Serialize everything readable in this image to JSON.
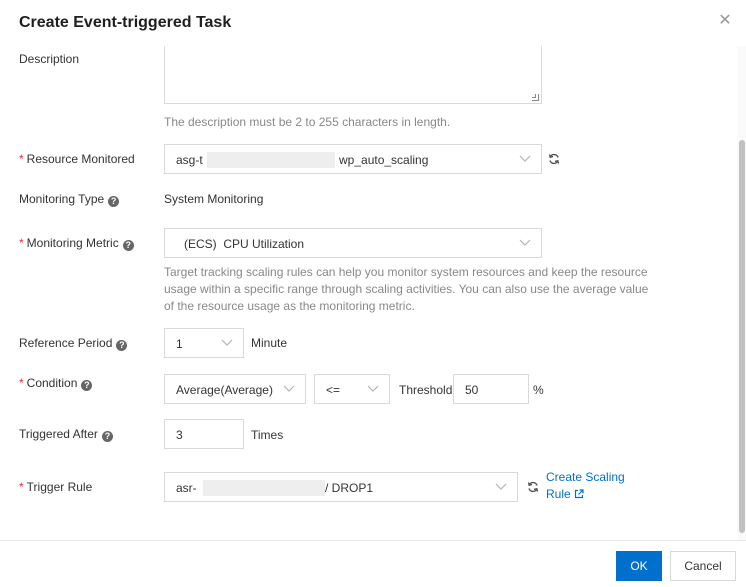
{
  "dialog": {
    "title": "Create Event-triggered Task"
  },
  "form": {
    "description": {
      "label": "Description",
      "value": "",
      "hint": "The description must be 2 to 255 characters in length."
    },
    "resource_monitored": {
      "label": "Resource Monitored",
      "value_prefix": "asg-t",
      "value_suffix": "wp_auto_scaling"
    },
    "monitoring_type": {
      "label": "Monitoring Type",
      "value": "System Monitoring"
    },
    "monitoring_metric": {
      "label": "Monitoring Metric",
      "value": "(ECS)  CPU Utilization",
      "hint_lines": [
        "Target tracking scaling rules can help you monitor system resources and keep the resource",
        "usage within a specific range through scaling activities. You can also use the average value",
        "of the resource usage as the monitoring metric."
      ]
    },
    "reference_period": {
      "label": "Reference Period",
      "value": "1",
      "unit": "Minute"
    },
    "condition": {
      "label": "Condition",
      "statistic": "Average(Average)",
      "operator": "<=",
      "threshold_label": "Threshold",
      "threshold_value": "50",
      "threshold_unit": "%"
    },
    "triggered_after": {
      "label": "Triggered After",
      "value": "3",
      "unit": "Times"
    },
    "trigger_rule": {
      "label": "Trigger Rule",
      "value_prefix": "asr-",
      "value_suffix": "/ DROP1",
      "link_line1": "Create Scaling",
      "link_line2": "Rule"
    }
  },
  "footer": {
    "ok_label": "OK",
    "cancel_label": "Cancel"
  },
  "colors": {
    "primary": "#0070cc",
    "required": "#f5222d",
    "hint": "#888888",
    "border": "#d9d9d9"
  },
  "icons": {
    "close": "close-icon",
    "help": "question-circle-icon",
    "chevron": "chevron-down-icon",
    "refresh": "refresh-icon",
    "external": "external-link-icon"
  }
}
